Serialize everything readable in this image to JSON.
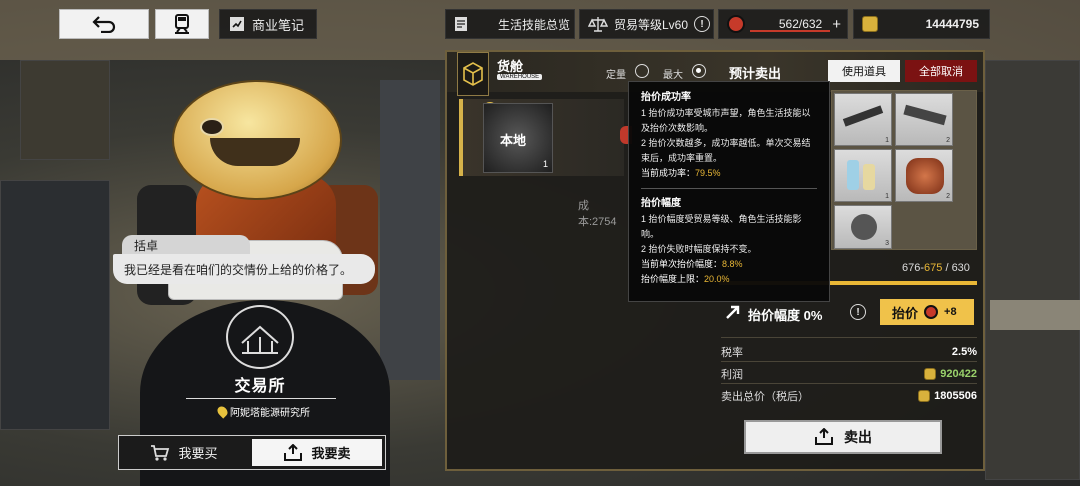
{
  "topbar": {
    "business_notes": "商业笔记",
    "life_skills": "生活技能总览",
    "trade_level": "贸易等级Lv60",
    "stamina": "562/632",
    "money": "14444795"
  },
  "dialog": {
    "speaker": "括卓",
    "text": "我已经是看在咱们的交情份上给的价格了。"
  },
  "station": {
    "name": "交易所",
    "location": "阿妮塔能源研究所"
  },
  "mode_toggle": {
    "buy": "我要买",
    "sell": "我要卖",
    "active": "sell"
  },
  "panel": {
    "cargo_title": "货舱",
    "cargo_badge": "WAREHOUSE",
    "fixed_label": "定量",
    "max_label": "最大",
    "selected_radio": "max",
    "presale_title": "预计卖出",
    "use_item_btn": "使用道具",
    "cancel_all_btn": "全部取消",
    "cargo_item": {
      "name": "本地",
      "qty": "1",
      "cost": "成本:2754"
    },
    "goods": [
      {
        "icon": "blades-icon",
        "qty": "1"
      },
      {
        "icon": "metal-parts-icon",
        "qty": "2"
      },
      {
        "icon": "bottles-icon",
        "qty": "1"
      },
      {
        "icon": "jar-icon",
        "qty": "2"
      },
      {
        "icon": "round-item-icon",
        "qty": "3"
      }
    ],
    "capacity": {
      "current": "676",
      "projected": "675",
      "max": "630",
      "fill_fraction": 1.0
    },
    "raise": {
      "label": "抬价幅度",
      "value": "0%",
      "button": "抬价",
      "cost": "+8"
    },
    "tax_label": "税率",
    "tax_value": "2.5%",
    "profit_label": "利润",
    "profit_value": "920422",
    "total_label": "卖出总价（税后）",
    "total_value": "1805506",
    "sell_btn": "卖出"
  },
  "tooltip": {
    "success_title": "抬价成功率",
    "success_line1": "1 抬价成功率受城市声望，角色生活技能以及抬价次数影响。",
    "success_line2": "2 抬价次数越多，成功率越低。单次交易结束后，成功率重置。",
    "success_current_label": "当前成功率：",
    "success_current_value": "79.5%",
    "range_title": "抬价幅度",
    "range_line1": "1 抬价幅度受贸易等级、角色生活技能影响。",
    "range_line2": "2 抬价失败时幅度保持不变。",
    "range_current_label": "当前单次抬价幅度：",
    "range_current_value": "8.8%",
    "range_cap_label": "抬价幅度上限：",
    "range_cap_value": "20.0%"
  },
  "colors": {
    "accent_gold": "#e9b736",
    "cancel_red": "#7b1212",
    "profit_green": "#9ad26b"
  }
}
